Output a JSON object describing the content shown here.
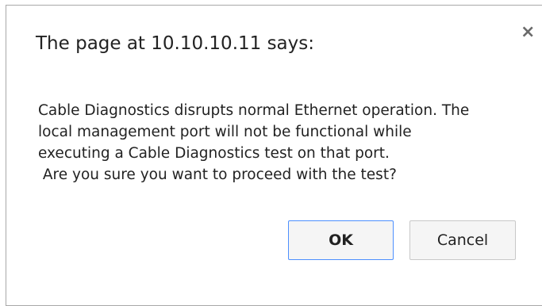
{
  "dialog": {
    "title": "The page at 10.10.10.11 says:",
    "close_symbol": "×",
    "close_icon": "close-icon",
    "message_lines": [
      "Cable Diagnostics disrupts normal Ethernet operation. The",
      "local management port will not be functional while",
      "executing a Cable Diagnostics test on that port.",
      " Are you sure you want to proceed with the test?"
    ],
    "ok_label": "OK",
    "cancel_label": "Cancel"
  },
  "colors": {
    "ok_border": "#4d90fe",
    "button_bg": "#f5f5f5",
    "text": "#222222"
  }
}
